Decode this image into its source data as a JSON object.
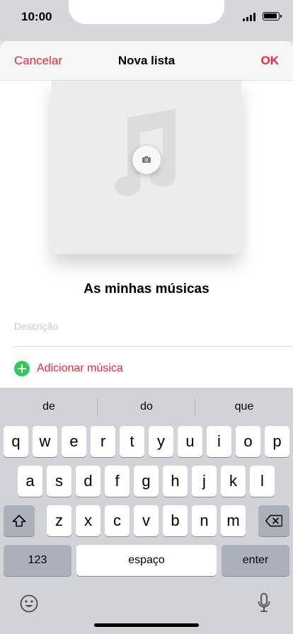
{
  "status_bar": {
    "time": "10:00"
  },
  "nav": {
    "cancel": "Cancelar",
    "title": "Nova lista",
    "done": "OK"
  },
  "playlist": {
    "name": "As minhas músicas",
    "description_placeholder": "Descrição",
    "add_music": "Adicionar música"
  },
  "keyboard": {
    "suggestions": [
      "de",
      "do",
      "que"
    ],
    "row1": [
      "q",
      "w",
      "e",
      "r",
      "t",
      "y",
      "u",
      "i",
      "o",
      "p"
    ],
    "row2": [
      "a",
      "s",
      "d",
      "f",
      "g",
      "h",
      "j",
      "k",
      "l"
    ],
    "row3": [
      "z",
      "x",
      "c",
      "v",
      "b",
      "n",
      "m"
    ],
    "numbers": "123",
    "space": "espaço",
    "enter": "enter"
  },
  "colors": {
    "accent": "#fa233b",
    "add_icon": "#34c759"
  }
}
